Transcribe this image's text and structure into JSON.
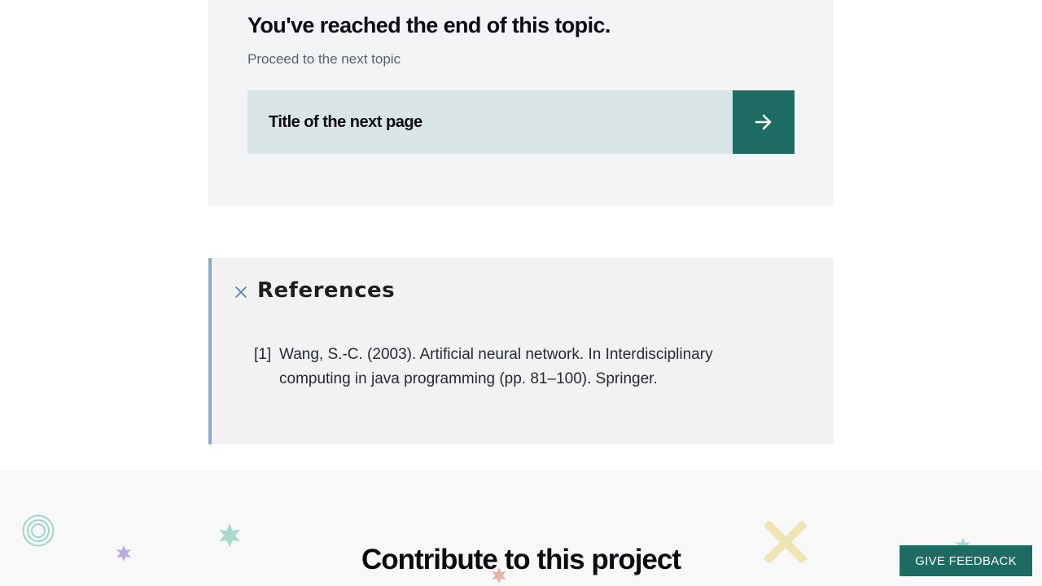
{
  "end_card": {
    "title": "You've reached the end of this topic.",
    "subtitle": "Proceed to the next topic",
    "next_page_title": "Title of the next page",
    "arrow_icon": "arrow-right-icon"
  },
  "references": {
    "title": "References",
    "close_icon": "close-icon",
    "items": [
      {
        "number": "[1]",
        "text": "Wang, S.-C. (2003). Artificial neural network. In Interdisciplinary computing in java programming (pp. 81–100). Springer."
      }
    ]
  },
  "footer": {
    "title": "Contribute to this project"
  },
  "feedback_button": {
    "label": "GIVE FEEDBACK"
  },
  "colors": {
    "accent": "#1e6b63",
    "next_link_bg": "#d9e5e6",
    "card_bg": "#f3f4f6",
    "references_bg": "#f2f2f2",
    "references_border": "#8fa9c9"
  }
}
